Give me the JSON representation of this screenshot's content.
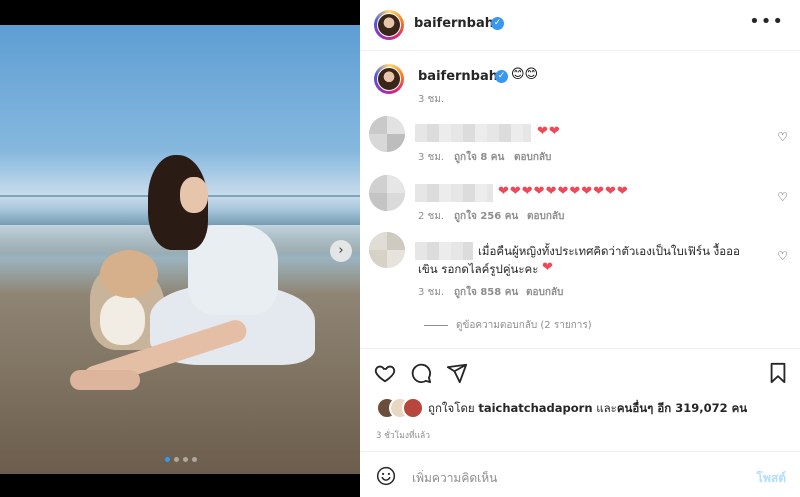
{
  "header": {
    "username": "baifernbah",
    "more_icon": "more-horizontal-icon"
  },
  "caption": {
    "username": "baifernbah",
    "emojis": "😊😊",
    "time": "3 ชม."
  },
  "comments": [
    {
      "hearts": "❤❤",
      "time": "3 ชม.",
      "likes": "ถูกใจ 8 คน",
      "reply": "ตอบกลับ"
    },
    {
      "hearts": "❤❤❤❤❤❤❤❤❤❤❤",
      "time": "2 ชม.",
      "likes": "ถูกใจ 256 คน",
      "reply": "ตอบกลับ"
    },
    {
      "text_line1": "เมื่อคืนผู้หญิงทั้งประเทศคิดว่าตัวเองเป็นใบเฟิร์น งื้อออ",
      "text_line2": "เขิน รอกดไลค์รูปคู่นะคะ",
      "heart": "❤",
      "time": "3 ชม.",
      "likes": "ถูกใจ 858 คน",
      "reply": "ตอบกลับ",
      "view_replies": "ดูข้อความตอบกลับ (2 รายการ)"
    }
  ],
  "actions": {
    "like_icon": "heart-icon",
    "comment_icon": "comment-icon",
    "share_icon": "send-icon",
    "save_icon": "bookmark-icon"
  },
  "likes": {
    "prefix": "ถูกใจโดย",
    "user": "taichatchadaporn",
    "middle": "และ",
    "others": "คนอื่นๆ อีก 319,072 คน"
  },
  "timestamp": "3 ชั่วโมงที่แล้ว",
  "comment_box": {
    "placeholder": "เพิ่มความคิดเห็น",
    "post_label": "โพสต์",
    "emoji_icon": "smile-icon"
  },
  "carousel": {
    "current_index": 1,
    "total": 4,
    "next_icon": "chevron-right-icon"
  },
  "colors": {
    "link_blue": "#3897f0",
    "heart_red": "#ed4956",
    "post_disabled": "#b2dffc"
  }
}
